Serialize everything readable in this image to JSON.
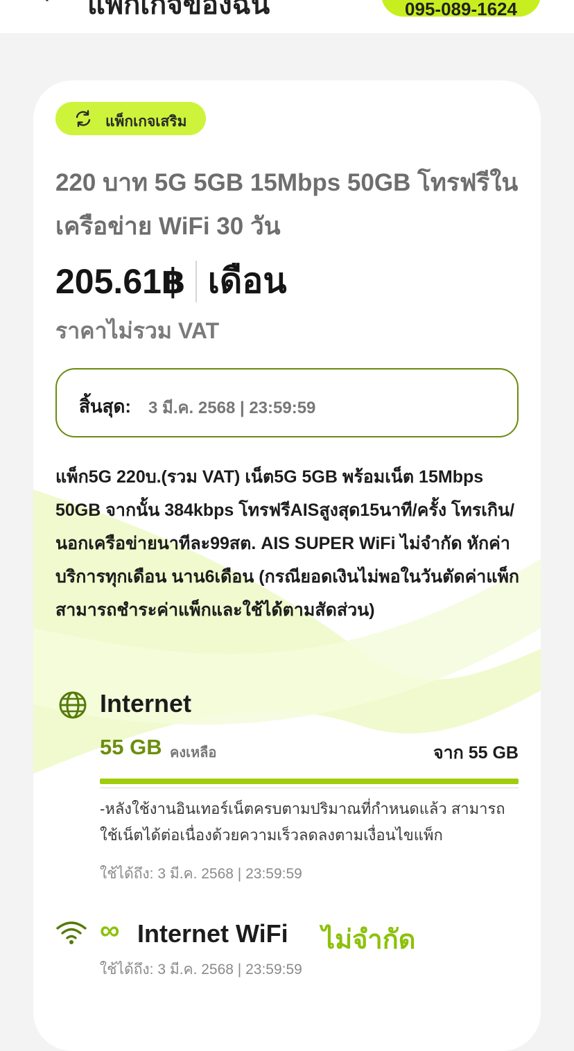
{
  "header": {
    "title": "แพ็กเกจของฉัน",
    "phone": "095-089-1624"
  },
  "package": {
    "chip_label": "แพ็กเกจเสริม",
    "title": "220 บาท 5G 5GB 15Mbps 50GB โทรฟรีในเครือข่าย WiFi 30 วัน",
    "price": "205.61฿",
    "period": "เดือน",
    "vat_note": "ราคาไม่รวม VAT",
    "expiry_label": "สิ้นสุด:",
    "expiry_value": "3 มี.ค. 2568 | 23:59:59",
    "description": "แพ็ก5G 220บ.(รวม VAT) เน็ต5G 5GB พร้อมเน็ต 15Mbps 50GB จากนั้น 384kbps โทรฟรีAISสูงสุด15นาที/ครั้ง โทรเกิน/นอกเครือข่ายนาทีละ99สต. AIS SUPER WiFi ไม่จำกัด หักค่าบริการทุกเดือน นาน6เดือน (กรณียอดเงินไม่พอในวันตัดค่าแพ็ก สามารถชำระค่าแพ็กและใช้ได้ตามสัดส่วน)"
  },
  "internet": {
    "label": "Internet",
    "remaining": "55 GB",
    "remaining_label": "คงเหลือ",
    "total": "จาก 55 GB",
    "progress_fraction": 1.0,
    "note": "-หลังใช้งานอินเทอร์เน็ตครบตามปริมาณที่กำหนดแล้ว สามารถใช้เน็ตได้ต่อเนื่องด้วยความเร็วลดลงตามเงื่อนไขแพ็ก",
    "valid_until": "ใช้ได้ถึง: 3 มี.ค. 2568 | 23:59:59"
  },
  "wifi": {
    "infinity": "∞",
    "label": "Internet WiFi",
    "unlimited": "ไม่จำกัด",
    "valid_until": "ใช้ได้ถึง: 3 มี.ค. 2568 | 23:59:59"
  },
  "colors": {
    "accent": "#cdf43a",
    "accent_dark": "#6c8e0c",
    "progress": "#9fcd0b"
  }
}
